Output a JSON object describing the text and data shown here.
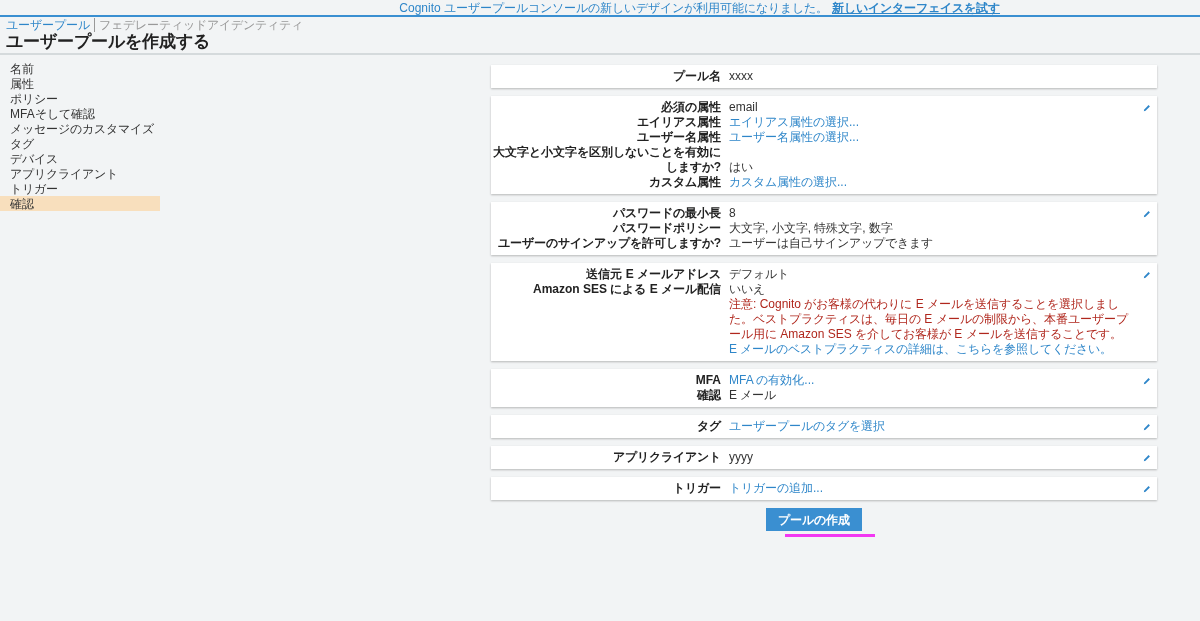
{
  "banner": {
    "text": "Cognito ユーザープールコンソールの新しいデザインが利用可能になりました。",
    "link": "新しいインターフェイスを試す"
  },
  "breadcrumb": [
    {
      "label": "ユーザープール",
      "selected": true
    },
    {
      "label": "フェデレーティッドアイデンティティ",
      "selected": false
    }
  ],
  "title": "ユーザープールを作成する",
  "sidebar": {
    "items": [
      {
        "label": "名前",
        "selected": false
      },
      {
        "label": "属性",
        "selected": false
      },
      {
        "label": "ポリシー",
        "selected": false
      },
      {
        "label": "MFAそして確認",
        "selected": false
      },
      {
        "label": "メッセージのカスタマイズ",
        "selected": false
      },
      {
        "label": "タグ",
        "selected": false
      },
      {
        "label": "デバイス",
        "selected": false
      },
      {
        "label": "アプリクライアント",
        "selected": false
      },
      {
        "label": "トリガー",
        "selected": false
      },
      {
        "label": "確認",
        "selected": true
      }
    ]
  },
  "sections": [
    {
      "editable": false,
      "rows": [
        {
          "label": "プール名",
          "kind": "text",
          "value": "xxxx"
        }
      ]
    },
    {
      "editable": true,
      "rows": [
        {
          "label": "必須の属性",
          "kind": "text",
          "value": "email"
        },
        {
          "label": "エイリアス属性",
          "kind": "link",
          "value": "エイリアス属性の選択..."
        },
        {
          "label": "ユーザー名属性",
          "kind": "link",
          "value": "ユーザー名属性の選択..."
        },
        {
          "label": "大文字と小文字を区別しないことを有効にしますか?",
          "kind": "text",
          "value": "はい"
        },
        {
          "label": "カスタム属性",
          "kind": "link",
          "value": "カスタム属性の選択..."
        }
      ]
    },
    {
      "editable": true,
      "rows": [
        {
          "label": "パスワードの最小長",
          "kind": "text",
          "value": "8"
        },
        {
          "label": "パスワードポリシー",
          "kind": "text",
          "value": "大文字, 小文字, 特殊文字, 数字"
        },
        {
          "label": "ユーザーのサインアップを許可しますか?",
          "kind": "text",
          "value": "ユーザーは自己サインアップできます"
        }
      ]
    },
    {
      "editable": true,
      "rows": [
        {
          "label": "送信元 E メールアドレス",
          "kind": "text",
          "value": "デフォルト"
        },
        {
          "label": "Amazon SES による E メール配信",
          "kind": "text",
          "value": "いいえ"
        },
        {
          "kind": "note",
          "value": "注意: Cognito がお客様の代わりに E メールを送信することを選択しました。ベストプラクティスは、毎日の E メールの制限から、本番ユーザープール用に Amazon SES を介してお客様が E メールを送信することです。",
          "link": "E メールのベストプラクティスの詳細は、こちらを参照してください。"
        }
      ]
    },
    {
      "editable": true,
      "rows": [
        {
          "label": "MFA",
          "kind": "link",
          "value": "MFA の有効化..."
        },
        {
          "label": "確認",
          "kind": "text",
          "value": "E メール"
        }
      ]
    },
    {
      "editable": true,
      "rows": [
        {
          "label": "タグ",
          "kind": "link",
          "value": "ユーザープールのタグを選択"
        }
      ]
    },
    {
      "editable": true,
      "rows": [
        {
          "label": "アプリクライアント",
          "kind": "text",
          "value": "yyyy"
        }
      ]
    },
    {
      "editable": true,
      "rows": [
        {
          "label": "トリガー",
          "kind": "link",
          "value": "トリガーの追加..."
        }
      ]
    }
  ],
  "create_button": "プールの作成"
}
